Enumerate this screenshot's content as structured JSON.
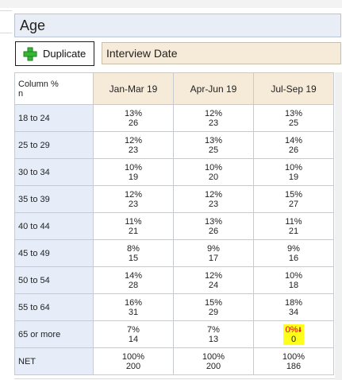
{
  "title": "Age",
  "duplicate_button": {
    "label": "Duplicate",
    "icon": "plus-icon",
    "icon_color": "#2ea52e"
  },
  "variable": {
    "label": "Interview Date"
  },
  "table": {
    "corner_line1": "Column %",
    "corner_line2": "n",
    "columns": [
      "Jan-Mar 19",
      "Apr-Jun 19",
      "Jul-Sep 19"
    ],
    "rows": [
      {
        "label": "18 to 24",
        "cells": [
          {
            "pct": "13%",
            "n": "26"
          },
          {
            "pct": "12%",
            "n": "23"
          },
          {
            "pct": "13%",
            "n": "25"
          }
        ]
      },
      {
        "label": "25 to 29",
        "cells": [
          {
            "pct": "12%",
            "n": "23"
          },
          {
            "pct": "13%",
            "n": "25"
          },
          {
            "pct": "14%",
            "n": "26"
          }
        ]
      },
      {
        "label": "30 to 34",
        "cells": [
          {
            "pct": "10%",
            "n": "19"
          },
          {
            "pct": "10%",
            "n": "20"
          },
          {
            "pct": "10%",
            "n": "19"
          }
        ]
      },
      {
        "label": "35 to 39",
        "cells": [
          {
            "pct": "12%",
            "n": "23"
          },
          {
            "pct": "12%",
            "n": "23"
          },
          {
            "pct": "15%",
            "n": "27"
          }
        ]
      },
      {
        "label": "40 to 44",
        "cells": [
          {
            "pct": "11%",
            "n": "21"
          },
          {
            "pct": "13%",
            "n": "26"
          },
          {
            "pct": "11%",
            "n": "21"
          }
        ]
      },
      {
        "label": "45 to 49",
        "cells": [
          {
            "pct": "8%",
            "n": "15"
          },
          {
            "pct": "9%",
            "n": "17"
          },
          {
            "pct": "9%",
            "n": "16"
          }
        ]
      },
      {
        "label": "50 to 54",
        "cells": [
          {
            "pct": "14%",
            "n": "28"
          },
          {
            "pct": "12%",
            "n": "24"
          },
          {
            "pct": "10%",
            "n": "18"
          }
        ]
      },
      {
        "label": "55 to 64",
        "cells": [
          {
            "pct": "16%",
            "n": "31"
          },
          {
            "pct": "15%",
            "n": "29"
          },
          {
            "pct": "18%",
            "n": "34"
          }
        ]
      },
      {
        "label": "65 or more",
        "cells": [
          {
            "pct": "7%",
            "n": "14"
          },
          {
            "pct": "7%",
            "n": "13"
          },
          {
            "pct": "0%",
            "n": "0",
            "highlight": true,
            "arrow": "down-arrow"
          }
        ]
      },
      {
        "label": "NET",
        "cells": [
          {
            "pct": "100%",
            "n": "200"
          },
          {
            "pct": "100%",
            "n": "200"
          },
          {
            "pct": "100%",
            "n": "186"
          }
        ]
      }
    ]
  },
  "colors": {
    "title_bg": "#e9eef6",
    "column_header_bg": "#f6ebd8",
    "row_header_bg": "#e6edf8",
    "highlight_bg": "#ffff1a",
    "significance_color": "#e00000"
  }
}
